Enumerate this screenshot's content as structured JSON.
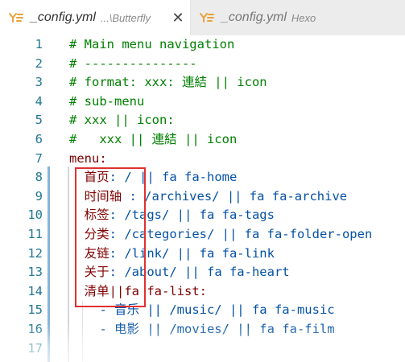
{
  "tabs": [
    {
      "name": "_config.yml",
      "description": "...\\Butterfly",
      "close_glyph": "✕"
    },
    {
      "name": "_config.yml",
      "description": "Hexo"
    }
  ],
  "colors": {
    "comment": "#008000",
    "key": "#800000",
    "value": "#0451a5",
    "line_number": "#237893",
    "yml_icon": "#e9a23b",
    "highlight_box": "#e03030"
  },
  "icons": {
    "tab_file_icon": "yaml-file-icon",
    "tab_close_icon": "close-icon"
  },
  "editor": {
    "lines": [
      {
        "num": "1",
        "parts": [
          {
            "t": "# Main menu navigation",
            "c": "comment"
          }
        ]
      },
      {
        "num": "2",
        "parts": [
          {
            "t": "# ---------------",
            "c": "comment"
          }
        ]
      },
      {
        "num": "3",
        "parts": [
          {
            "t": "# format: xxx: 連結 || icon",
            "c": "comment"
          }
        ]
      },
      {
        "num": "4",
        "parts": [
          {
            "t": "# sub-menu",
            "c": "comment"
          }
        ]
      },
      {
        "num": "5",
        "parts": [
          {
            "t": "# xxx || icon:",
            "c": "comment"
          }
        ]
      },
      {
        "num": "6",
        "parts": [
          {
            "t": "#   xxx || 連結 || icon",
            "c": "comment"
          }
        ]
      },
      {
        "num": "7",
        "parts": [
          {
            "t": "menu:",
            "c": "key"
          }
        ]
      },
      {
        "num": "8",
        "parts": [
          {
            "t": "  首页",
            "c": "key"
          },
          {
            "t": ": / || fa fa-home",
            "c": "val"
          }
        ]
      },
      {
        "num": "9",
        "parts": [
          {
            "t": "  时间轴 ",
            "c": "key"
          },
          {
            "t": ": /archives/ || fa fa-archive",
            "c": "val"
          }
        ]
      },
      {
        "num": "10",
        "parts": [
          {
            "t": "  标签",
            "c": "key"
          },
          {
            "t": ": /tags/ || fa fa-tags",
            "c": "val"
          }
        ]
      },
      {
        "num": "11",
        "parts": [
          {
            "t": "  分类",
            "c": "key"
          },
          {
            "t": ": /categories/ || fa fa-folder-open",
            "c": "val"
          }
        ]
      },
      {
        "num": "12",
        "parts": [
          {
            "t": "  友链",
            "c": "key"
          },
          {
            "t": ": /link/ || fa fa-link",
            "c": "val"
          }
        ]
      },
      {
        "num": "13",
        "parts": [
          {
            "t": "  关于",
            "c": "key"
          },
          {
            "t": ": /about/ || fa fa-heart",
            "c": "val"
          }
        ]
      },
      {
        "num": "14",
        "parts": [
          {
            "t": "  清单||fa fa-list:",
            "c": "key"
          }
        ]
      },
      {
        "num": "15",
        "parts": [
          {
            "t": "    - 音乐 || /music/ || fa fa-music",
            "c": "val"
          }
        ]
      },
      {
        "num": "16",
        "parts": [
          {
            "t": "    - 电影 || /movies/ || fa fa-film",
            "c": "val"
          }
        ]
      },
      {
        "num": "17",
        "parts": []
      }
    ]
  }
}
